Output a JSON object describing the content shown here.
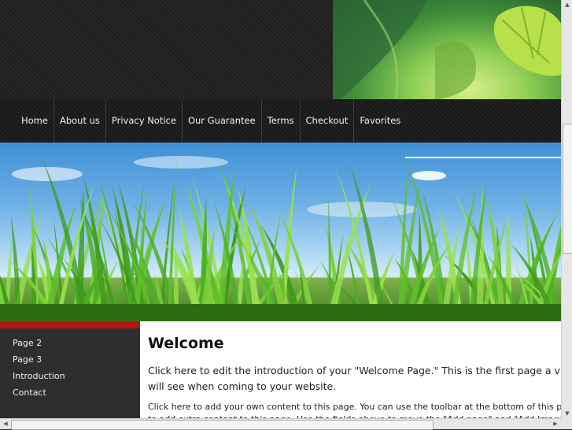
{
  "nav": {
    "items": [
      "Home",
      "About us",
      "Privacy Notice",
      "Our Guarantee",
      "Terms",
      "Checkout",
      "Favorites"
    ]
  },
  "sidebar": {
    "items": [
      "Page 2",
      "Page 3",
      "Introduction",
      "Contact"
    ]
  },
  "content": {
    "title": "Welcome",
    "intro": "Click here to edit the introduction of your \"Welcome Page.\" This is the first page a visitor will see when coming to your website.",
    "body": "Click here to add your own content to this page. You can use the toolbar at the bottom of this page to add extra content to this page. Use the fields above to move the \"Add page\" and \"Add Images\" buttons."
  },
  "colors": {
    "accent": "#b3150f",
    "nav_bg": "#1c1c1c",
    "sidebar_bg": "#2e2e2e"
  }
}
